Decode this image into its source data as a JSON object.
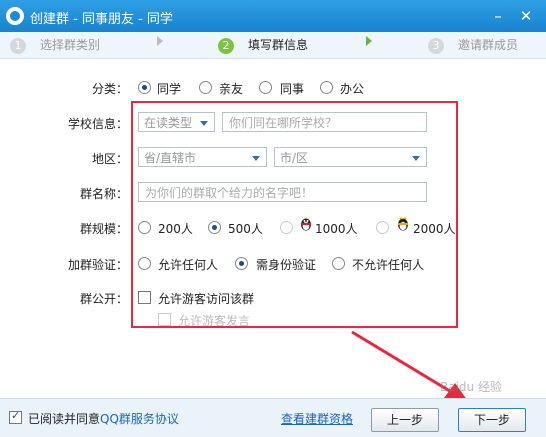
{
  "window": {
    "title": "创建群 - 同事朋友 - 同学"
  },
  "steps": [
    {
      "num": "1",
      "label": "选择群类别"
    },
    {
      "num": "2",
      "label": "填写群信息"
    },
    {
      "num": "3",
      "label": "邀请群成员"
    }
  ],
  "form": {
    "category": {
      "label": "分类：",
      "options": [
        "同学",
        "亲友",
        "同事",
        "办公"
      ],
      "selected": "同学"
    },
    "school": {
      "label": "学校信息：",
      "type_select": "在读类型",
      "name_placeholder": "你们同在哪所学校？"
    },
    "region": {
      "label": "地区：",
      "province": "省/直辖市",
      "city": "市/区"
    },
    "group_name": {
      "label": "群名称：",
      "placeholder": "为你们的群取个给力的名字吧！"
    },
    "scale": {
      "label": "群规模：",
      "options": [
        "200人",
        "500人",
        "1000人",
        "2000人"
      ],
      "selected": "500人"
    },
    "verify": {
      "label": "加群验证：",
      "options": [
        "允许任何人",
        "需身份验证",
        "不允许任何人"
      ],
      "selected": "需身份验证"
    },
    "public": {
      "label": "群公开：",
      "allow_visit": "允许游客访问该群",
      "allow_speak": "允许游客发言"
    }
  },
  "footer": {
    "agree_text": "已阅读并同意",
    "agree_link": "QQ群服务协议",
    "view_link": "查看建群资格",
    "prev": "上一步",
    "next": "下一步"
  },
  "watermark": "Baidu 经验",
  "colors": {
    "titlebar": "#1d8ad6",
    "highlight": "#e8283c",
    "active_step": "#7dc243"
  }
}
